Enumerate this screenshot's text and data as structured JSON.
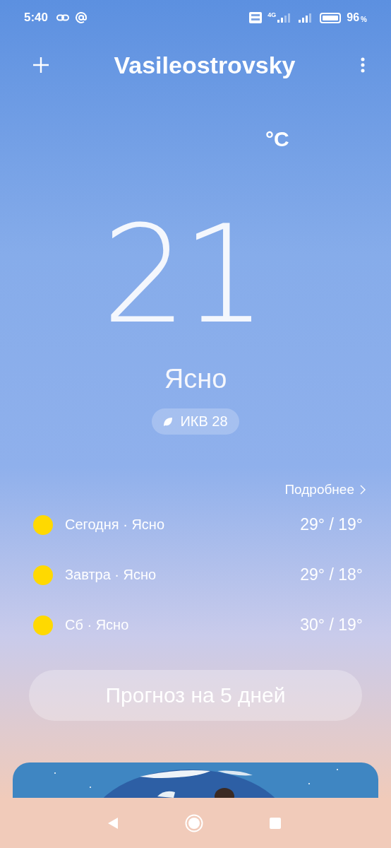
{
  "status_bar": {
    "time": "5:40",
    "network": "4G",
    "battery": "96",
    "battery_unit": "%"
  },
  "header": {
    "city": "Vasileostrovsky"
  },
  "current": {
    "temperature": "21",
    "unit": "°C",
    "condition": "Ясно",
    "aqi": "ИКВ 28"
  },
  "details_link": "Подробнее",
  "forecast": [
    {
      "day": "Сегодня · Ясно",
      "temps": "29° / 19°"
    },
    {
      "day": "Завтра · Ясно",
      "temps": "29° / 18°"
    },
    {
      "day": "Сб · Ясно",
      "temps": "30° / 19°"
    }
  ],
  "forecast_button": "Прогноз на 5 дней"
}
